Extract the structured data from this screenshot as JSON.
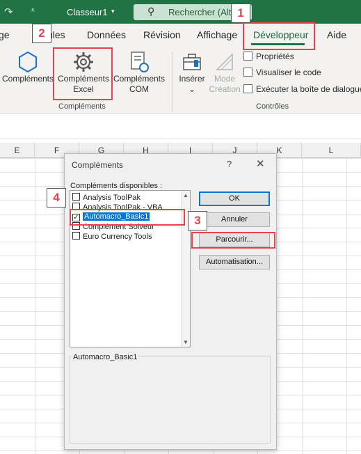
{
  "titlebar": {
    "undo_icon": "redo-arrow-icon",
    "qat_icon": "customize-qat-icon",
    "document": "Classeur1",
    "doc_dropdown_icon": "chevron-down-icon",
    "search_placeholder": "Rechercher (Alt+",
    "search_icon": "search-icon",
    "bg": "#217346"
  },
  "tabs": [
    "ge",
    "ules",
    "Données",
    "Révision",
    "Affichage",
    "Développeur",
    "Aide"
  ],
  "active_tab": "Développeur",
  "ribbon": {
    "complements": {
      "label": "Compléments",
      "icon": "hexagon-addins-icon"
    },
    "complements_excel": {
      "line1": "Compléments",
      "line2": "Excel",
      "icon": "gear-icon"
    },
    "complements_com": {
      "line1": "Compléments",
      "line2": "COM",
      "icon": "com-addins-icon"
    },
    "group_complements": "Compléments",
    "inserer": {
      "label": "Insérer",
      "icon": "toolbox-icon",
      "arrow": "⌄"
    },
    "mode_creation": {
      "line1": "Mode",
      "line2": "Création",
      "icon": "design-mode-icon"
    },
    "proprietes": "Propriétés",
    "visualiser": "Visualiser le code",
    "executer": "Exécuter la boîte de dialogue",
    "group_controles": "Contrôles"
  },
  "columns": [
    "E",
    "F",
    "G",
    "H",
    "I",
    "J",
    "K",
    "L"
  ],
  "dialog": {
    "title": "Compléments",
    "help": "?",
    "close": "✕",
    "list_label": "Compléments disponibles :",
    "items": [
      {
        "label": "Analysis ToolPak",
        "checked": false
      },
      {
        "label": "Analysis ToolPak - VBA",
        "checked": false
      },
      {
        "label": "Automacro_Basic1",
        "checked": true
      },
      {
        "label": "Complément Solveur",
        "checked": false
      },
      {
        "label": "Euro Currency Tools",
        "checked": false
      }
    ],
    "selected_index": 2,
    "ok": "OK",
    "annuler": "Annuler",
    "parcourir": "Parcourir...",
    "automatisation": "Automatisation...",
    "description_title": "Automacro_Basic1"
  },
  "annotations": [
    {
      "number": "1",
      "color": "#e8434a"
    },
    {
      "number": "2",
      "color": "#e8434a"
    },
    {
      "number": "3",
      "color": "#e8434a"
    },
    {
      "number": "4",
      "color": "#e8434a"
    }
  ]
}
